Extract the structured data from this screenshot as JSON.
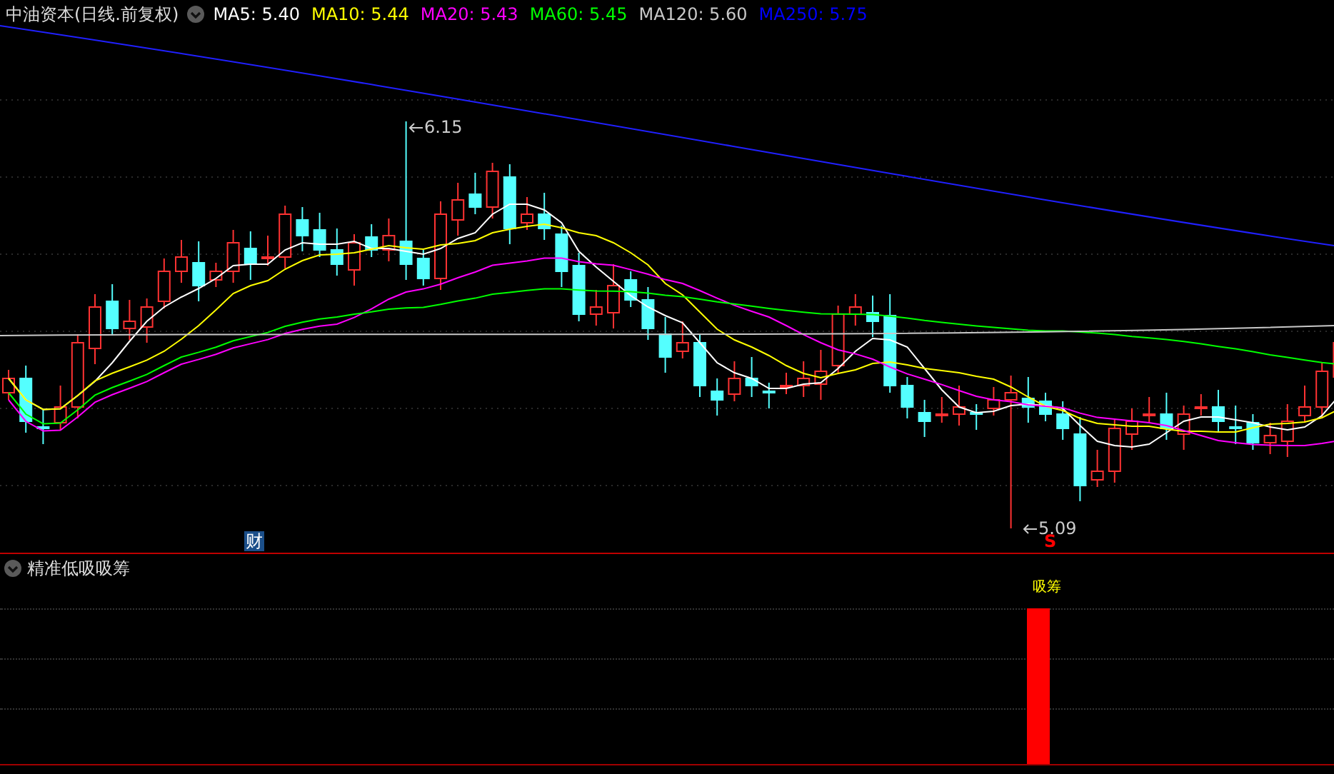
{
  "chart_header": {
    "title": "中油资本(日线.前复权)",
    "legend": [
      {
        "label": "MA5:",
        "value": "5.40",
        "color": "#ffffff"
      },
      {
        "label": "MA10:",
        "value": "5.44",
        "color": "#ffff00"
      },
      {
        "label": "MA20:",
        "value": "5.43",
        "color": "#ff00ff"
      },
      {
        "label": "MA60:",
        "value": "5.45",
        "color": "#00ff00"
      },
      {
        "label": "MA120:",
        "value": "5.60",
        "color": "#c8c8c8"
      },
      {
        "label": "MA250:",
        "value": "5.75",
        "color": "#0000ff"
      }
    ]
  },
  "price_panel": {
    "high_label": "6.15",
    "low_label": "5.09",
    "finance_badge": "财",
    "sell_marker": "S"
  },
  "indicator_panel": {
    "title": "精准低吸吸筹",
    "signal_label": "吸筹"
  }
}
